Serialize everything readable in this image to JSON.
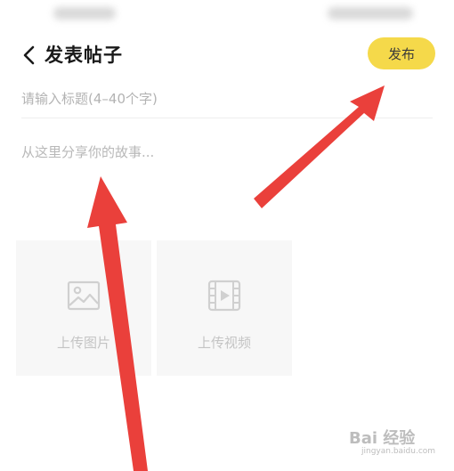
{
  "header": {
    "back_icon": "chevron-left-icon",
    "title": "发表帖子",
    "publish_label": "发布",
    "publish_color": "#f5d94a"
  },
  "form": {
    "title_placeholder": "请输入标题(4–40个字)",
    "content_placeholder": "从这里分享你的故事..."
  },
  "uploads": [
    {
      "icon": "image-icon",
      "label": "上传图片"
    },
    {
      "icon": "video-icon",
      "label": "上传视频"
    }
  ],
  "annotations": {
    "arrow_color": "#e8302a"
  },
  "watermark": {
    "text": "Bai 经验",
    "url": "jingyan.baidu.com"
  }
}
